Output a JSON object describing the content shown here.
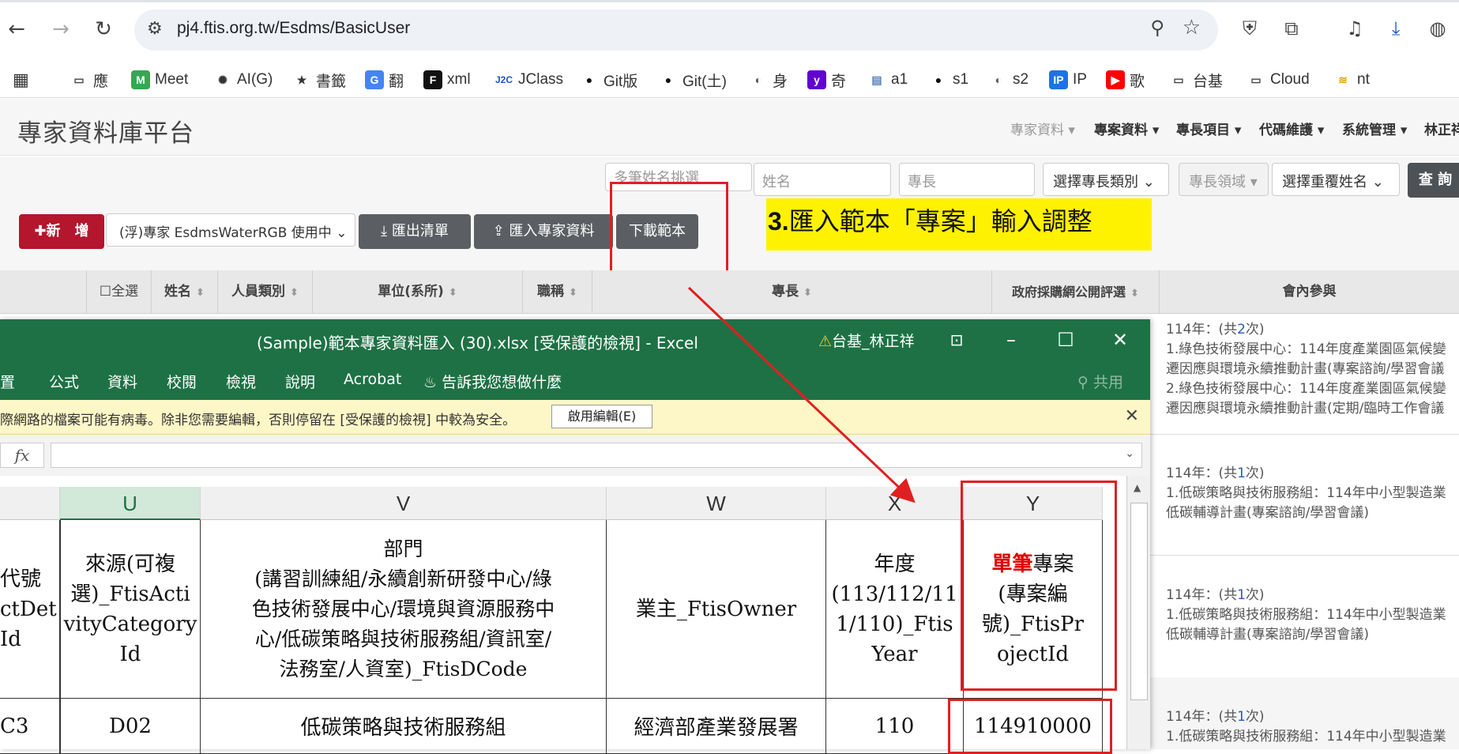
{
  "browser": {
    "url": "pj4.ftis.org.tw/Esdms/BasicUser",
    "bookmarks": [
      "應",
      "Meet",
      "AI(G)",
      "書籤",
      "翻",
      "xml",
      "JClass",
      "Git版",
      "Git(土)",
      "身",
      "奇",
      "a1",
      "s1",
      "s2",
      "IP",
      "歌",
      "台基",
      "Cloud",
      "nt"
    ]
  },
  "app": {
    "title": "專家資料庫平台",
    "nav": [
      "專家資料",
      "專案資料",
      "專長項目",
      "代碼維護",
      "系統管理",
      "林正祥"
    ],
    "filters": {
      "multi_name_placeholder": "多筆姓名挑選",
      "name_placeholder": "姓名",
      "expertise_placeholder": "專長",
      "expertise_category": "選擇專長類別",
      "expertise_domain": "專長領域",
      "duplicate_name": "選擇重覆姓名",
      "search_label": "查 詢"
    },
    "toolbar": {
      "add_label": "新　增",
      "role_select": "(浮)專家 EsdmsWaterRGB 使用中",
      "export_label": "匯出清單",
      "import_label": "匯入專家資料",
      "download_template_label": "下載範本"
    },
    "annotation": {
      "number": "3.",
      "text": "匯入範本「專案」輸入調整"
    },
    "grid_headers": [
      "全選",
      "姓名",
      "人員類別",
      "單位(系所)",
      "職稱",
      "專長",
      "政府採購網公開評選",
      "會內參與"
    ],
    "participation": [
      {
        "year_prefix": "114年：(共",
        "count": "2",
        "suffix": "次)",
        "lines": [
          "1.綠色技術發展中心：114年度產業園區氣候變",
          "遷因應與環境永續推動計畫(專案諮詢/學習會議",
          "2.綠色技術發展中心：114年度產業園區氣候變",
          "遷因應與環境永續推動計畫(定期/臨時工作會議"
        ]
      },
      {
        "year_prefix": "114年：(共",
        "count": "1",
        "suffix": "次)",
        "lines": [
          "1.低碳策略與技術服務組：114年中小型製造業",
          "低碳輔導計畫(專案諮詢/學習會議)"
        ]
      },
      {
        "year_prefix": "114年：(共",
        "count": "1",
        "suffix": "次)",
        "lines": [
          "1.低碳策略與技術服務組：114年中小型製造業",
          "低碳輔導計畫(專案諮詢/學習會議)"
        ]
      },
      {
        "year_prefix": "114年：(共",
        "count": "1",
        "suffix": "次)",
        "lines": [
          "1.低碳策略與技術服務組：114年中小型製造業"
        ]
      }
    ]
  },
  "excel": {
    "title": "(Sample)範本專家資料匯入 (30).xlsx  [受保護的檢視]  -  Excel",
    "user": "台基_林正祥",
    "menu": [
      "置",
      "公式",
      "資料",
      "校閱",
      "檢視",
      "說明",
      "Acrobat",
      "告訴我您想做什麼",
      "共用"
    ],
    "warning": "際網路的檔案可能有病毒。除非您需要編輯，否則停留在 [受保護的檢視] 中較為安全。",
    "enable_edit": "啟用編輯(E)",
    "columns": [
      "U",
      "V",
      "W",
      "X",
      "Y"
    ],
    "header_cells": {
      "T": [
        "代號",
        "ctDet",
        "Id"
      ],
      "U": [
        "來源(可複",
        "選)_FtisActi",
        "vityCategory",
        "Id"
      ],
      "V": [
        "部門",
        "(講習訓練組/永續創新研發中心/綠",
        "色技術發展中心/環境與資源服務中",
        "心/低碳策略與技術服務組/資訊室/",
        "法務室/人資室)_FtisDCode"
      ],
      "W": [
        "業主_FtisOwner"
      ],
      "X": [
        "年度",
        "(113/112/11",
        "1/110)_Ftis",
        "Year"
      ],
      "Y_red": "單筆",
      "Y": [
        "專案",
        "(專案編",
        "號)_FtisPr",
        "ojectId"
      ]
    },
    "row1": {
      "T": "C3",
      "U": "D02",
      "V": "低碳策略與技術服務組",
      "W": "經濟部產業發展署",
      "X": "110",
      "Y": "114910000"
    }
  }
}
